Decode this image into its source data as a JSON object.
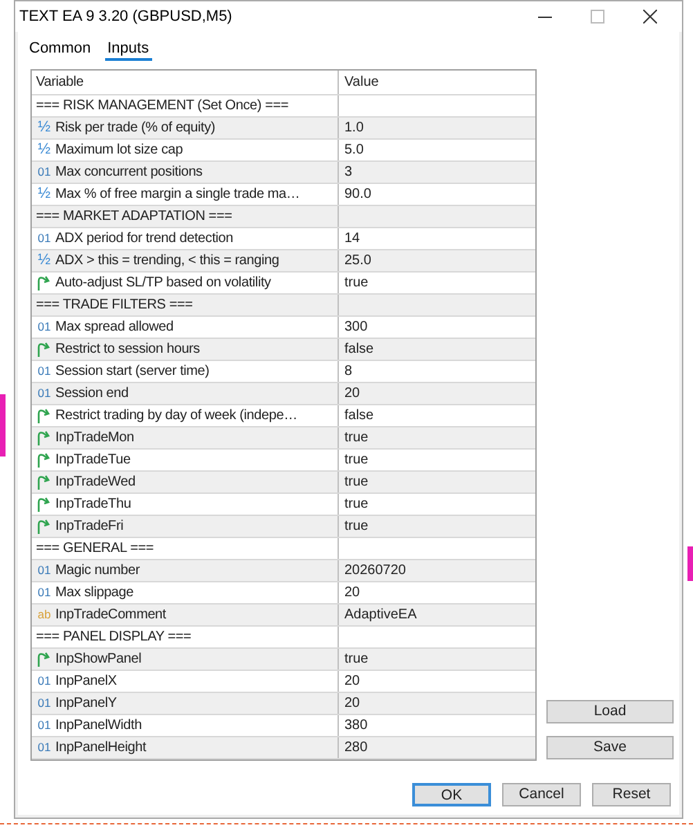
{
  "window": {
    "title": "TEXT EA 9 3.20 (GBPUSD,M5)"
  },
  "tabs": [
    {
      "label": "Common",
      "selected": false
    },
    {
      "label": "Inputs",
      "selected": true
    }
  ],
  "table": {
    "columns": [
      "Variable",
      "Value"
    ],
    "rows": [
      {
        "kind": "section",
        "variable": "=== RISK MANAGEMENT (Set Once) ===",
        "value": ""
      },
      {
        "kind": "double",
        "icon": "½",
        "variable": "Risk per trade (% of equity)",
        "value": "1.0"
      },
      {
        "kind": "double",
        "icon": "½",
        "variable": "Maximum lot size cap",
        "value": "5.0"
      },
      {
        "kind": "int",
        "icon": "01",
        "variable": "Max concurrent positions",
        "value": "3"
      },
      {
        "kind": "double",
        "icon": "½",
        "variable": "Max % of free margin a single trade ma…",
        "value": "90.0"
      },
      {
        "kind": "section",
        "variable": "=== MARKET ADAPTATION ===",
        "value": ""
      },
      {
        "kind": "int",
        "icon": "01",
        "variable": "ADX period for trend detection",
        "value": "14"
      },
      {
        "kind": "double",
        "icon": "½",
        "variable": "ADX > this = trending, < this = ranging",
        "value": "25.0"
      },
      {
        "kind": "bool",
        "variable": "Auto-adjust SL/TP based on volatility",
        "value": "true"
      },
      {
        "kind": "section",
        "variable": "=== TRADE FILTERS ===",
        "value": ""
      },
      {
        "kind": "int",
        "icon": "01",
        "variable": "Max spread allowed",
        "value": "300"
      },
      {
        "kind": "bool",
        "variable": "Restrict to session hours",
        "value": "false"
      },
      {
        "kind": "int",
        "icon": "01",
        "variable": "Session start (server time)",
        "value": "8"
      },
      {
        "kind": "int",
        "icon": "01",
        "variable": "Session end",
        "value": "20"
      },
      {
        "kind": "bool",
        "variable": "Restrict trading by day of week (indepe…",
        "value": "false"
      },
      {
        "kind": "bool",
        "variable": "InpTradeMon",
        "value": "true"
      },
      {
        "kind": "bool",
        "variable": "InpTradeTue",
        "value": "true"
      },
      {
        "kind": "bool",
        "variable": "InpTradeWed",
        "value": "true"
      },
      {
        "kind": "bool",
        "variable": "InpTradeThu",
        "value": "true"
      },
      {
        "kind": "bool",
        "variable": "InpTradeFri",
        "value": "true"
      },
      {
        "kind": "section",
        "variable": "=== GENERAL ===",
        "value": ""
      },
      {
        "kind": "int",
        "icon": "01",
        "variable": "Magic number",
        "value": "20260720"
      },
      {
        "kind": "int",
        "icon": "01",
        "variable": "Max slippage",
        "value": "20"
      },
      {
        "kind": "string",
        "icon": "ab",
        "variable": "InpTradeComment",
        "value": "AdaptiveEA"
      },
      {
        "kind": "section",
        "variable": "=== PANEL DISPLAY ===",
        "value": ""
      },
      {
        "kind": "bool",
        "variable": "InpShowPanel",
        "value": "true"
      },
      {
        "kind": "int",
        "icon": "01",
        "variable": "InpPanelX",
        "value": "20"
      },
      {
        "kind": "int",
        "icon": "01",
        "variable": "InpPanelY",
        "value": "20"
      },
      {
        "kind": "int",
        "icon": "01",
        "variable": "InpPanelWidth",
        "value": "380"
      },
      {
        "kind": "int",
        "icon": "01",
        "variable": "InpPanelHeight",
        "value": "280"
      }
    ]
  },
  "side_buttons": [
    "Load",
    "Save"
  ],
  "buttons": [
    "OK",
    "Cancel",
    "Reset"
  ]
}
